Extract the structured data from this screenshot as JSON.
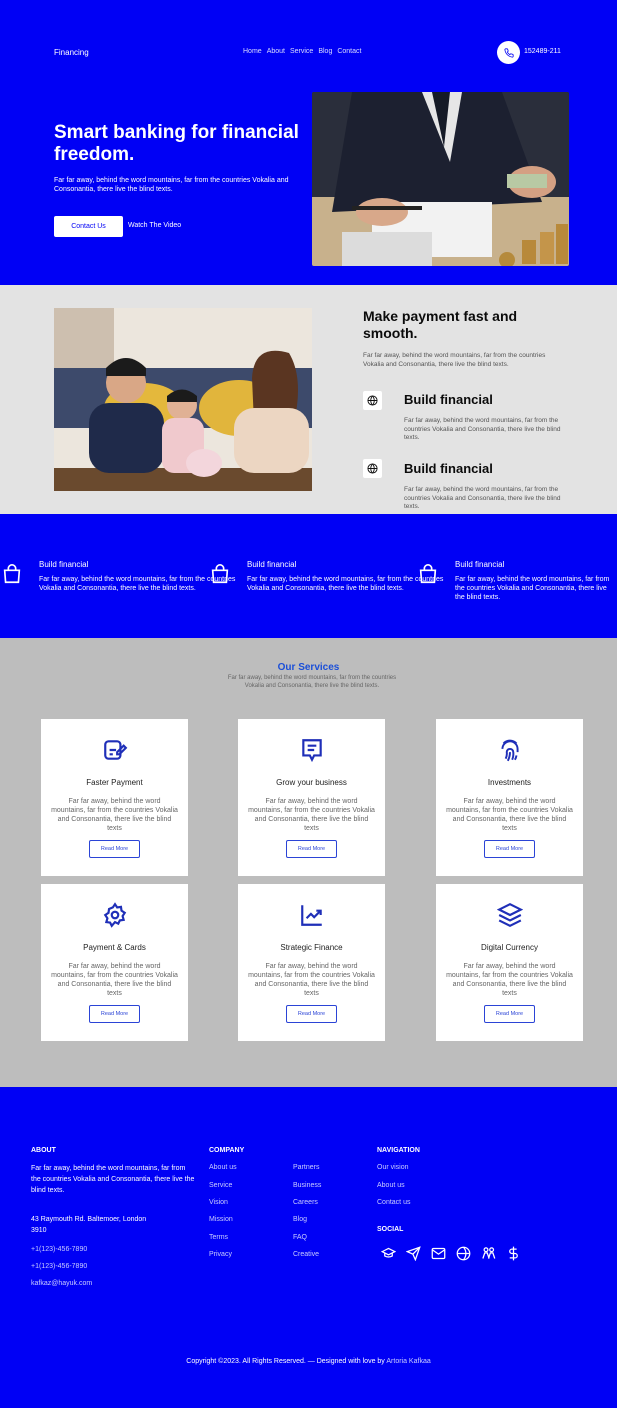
{
  "nav": {
    "brand": "Financing",
    "menu": [
      "Home",
      "About",
      "Service",
      "Blog",
      "Contact"
    ],
    "phone": "152489-211"
  },
  "hero": {
    "title": "Smart banking for financial freedom.",
    "text": "Far far away, behind the word mountains, far from the countries Vokalia and Consonantia, there live the blind texts.",
    "contact_btn": "Contact Us",
    "video_btn": "Watch The Video"
  },
  "about": {
    "title": "Make payment fast and smooth.",
    "text": "Far far away, behind the word mountains, far from the countries Vokalia and Consonantia, there live the blind texts.",
    "features": [
      {
        "title": "Build financial",
        "text": "Far far away, behind the word mountains, far from the countries Vokalia and Consonantia, there live the blind texts."
      },
      {
        "title": "Build financial",
        "text": "Far far away, behind the word mountains, far from the countries Vokalia and Consonantia, there live the blind texts."
      }
    ]
  },
  "strip": [
    {
      "title": "Build financial",
      "text": "Far far away, behind the word mountains, far from the countries Vokalia and Consonantia, there live the blind texts."
    },
    {
      "title": "Build financial",
      "text": "Far far away, behind the word mountains, far from the countries Vokalia and Consonantia, there live the blind texts."
    },
    {
      "title": "Build financial",
      "text": "Far far away, behind the word mountains, far from the countries Vokalia and Consonantia, there live the blind texts."
    }
  ],
  "services": {
    "heading": "Our Services",
    "subtext": "Far far away, behind the word mountains, far from the countries Vokalia and Consonantia, there live the blind texts.",
    "cards": [
      {
        "title": "Faster Payment",
        "icon": "payment-edit-icon",
        "text": "Far far away, behind the word mountains, far from the countries Vokalia and Consonantia, there live the blind texts",
        "btn": "Read More"
      },
      {
        "title": "Grow your business",
        "icon": "message-icon",
        "text": "Far far away, behind the word mountains, far from the countries Vokalia and Consonantia, there live the blind texts",
        "btn": "Read More"
      },
      {
        "title": "Investments",
        "icon": "fingerprint-icon",
        "text": "Far far away, behind the word mountains, far from the countries Vokalia and Consonantia, there live the blind texts",
        "btn": "Read More"
      },
      {
        "title": "Payment & Cards",
        "icon": "gear-icon",
        "text": "Far far away, behind the word mountains, far from the countries Vokalia and Consonantia, there live the blind texts",
        "btn": "Read More"
      },
      {
        "title": "Strategic Finance",
        "icon": "chart-icon",
        "text": "Far far away, behind the word mountains, far from the countries Vokalia and Consonantia, there live the blind texts",
        "btn": "Read More"
      },
      {
        "title": "Digital Currency",
        "icon": "layers-icon",
        "text": "Far far away, behind the word mountains, far from the countries Vokalia and Consonantia, there live the blind texts",
        "btn": "Read More"
      }
    ]
  },
  "footer": {
    "about_head": "ABOUT",
    "about_text": "Far far away, behind the word mountains, far from the countries Vokalia and Consonantia, there live the blind texts.",
    "address": "43 Raymouth Rd. Baltemoer, London 3910",
    "phone1": "+1(123)-456-7890",
    "phone2": "+1(123)-456-7890",
    "email": "kafkaz@hayuk.com",
    "company_head": "COMPANY",
    "company_col1": [
      "About us",
      "Service",
      "Vision",
      "Mission",
      "Terms",
      "Privacy"
    ],
    "company_col2": [
      "Partners",
      "Business",
      "Careers",
      "Blog",
      "FAQ",
      "Creative"
    ],
    "nav_head": "NAVIGATION",
    "nav_links": [
      "Our vision",
      "About us",
      "Contact us"
    ],
    "social_head": "SOCIAL",
    "social_icons": [
      "graduation-cap-icon",
      "send-icon",
      "mail-icon",
      "globe-icon",
      "people-icon",
      "dollar-icon"
    ],
    "copyright": "Copyright ©2023. All Rights Reserved. — Designed with love by",
    "author": "Artoria Kafkaa"
  },
  "colors": {
    "primary": "#0000f5",
    "about_bg": "#e3e3e3",
    "services_bg": "#bdbdbd",
    "accent": "#1b4fd8"
  }
}
